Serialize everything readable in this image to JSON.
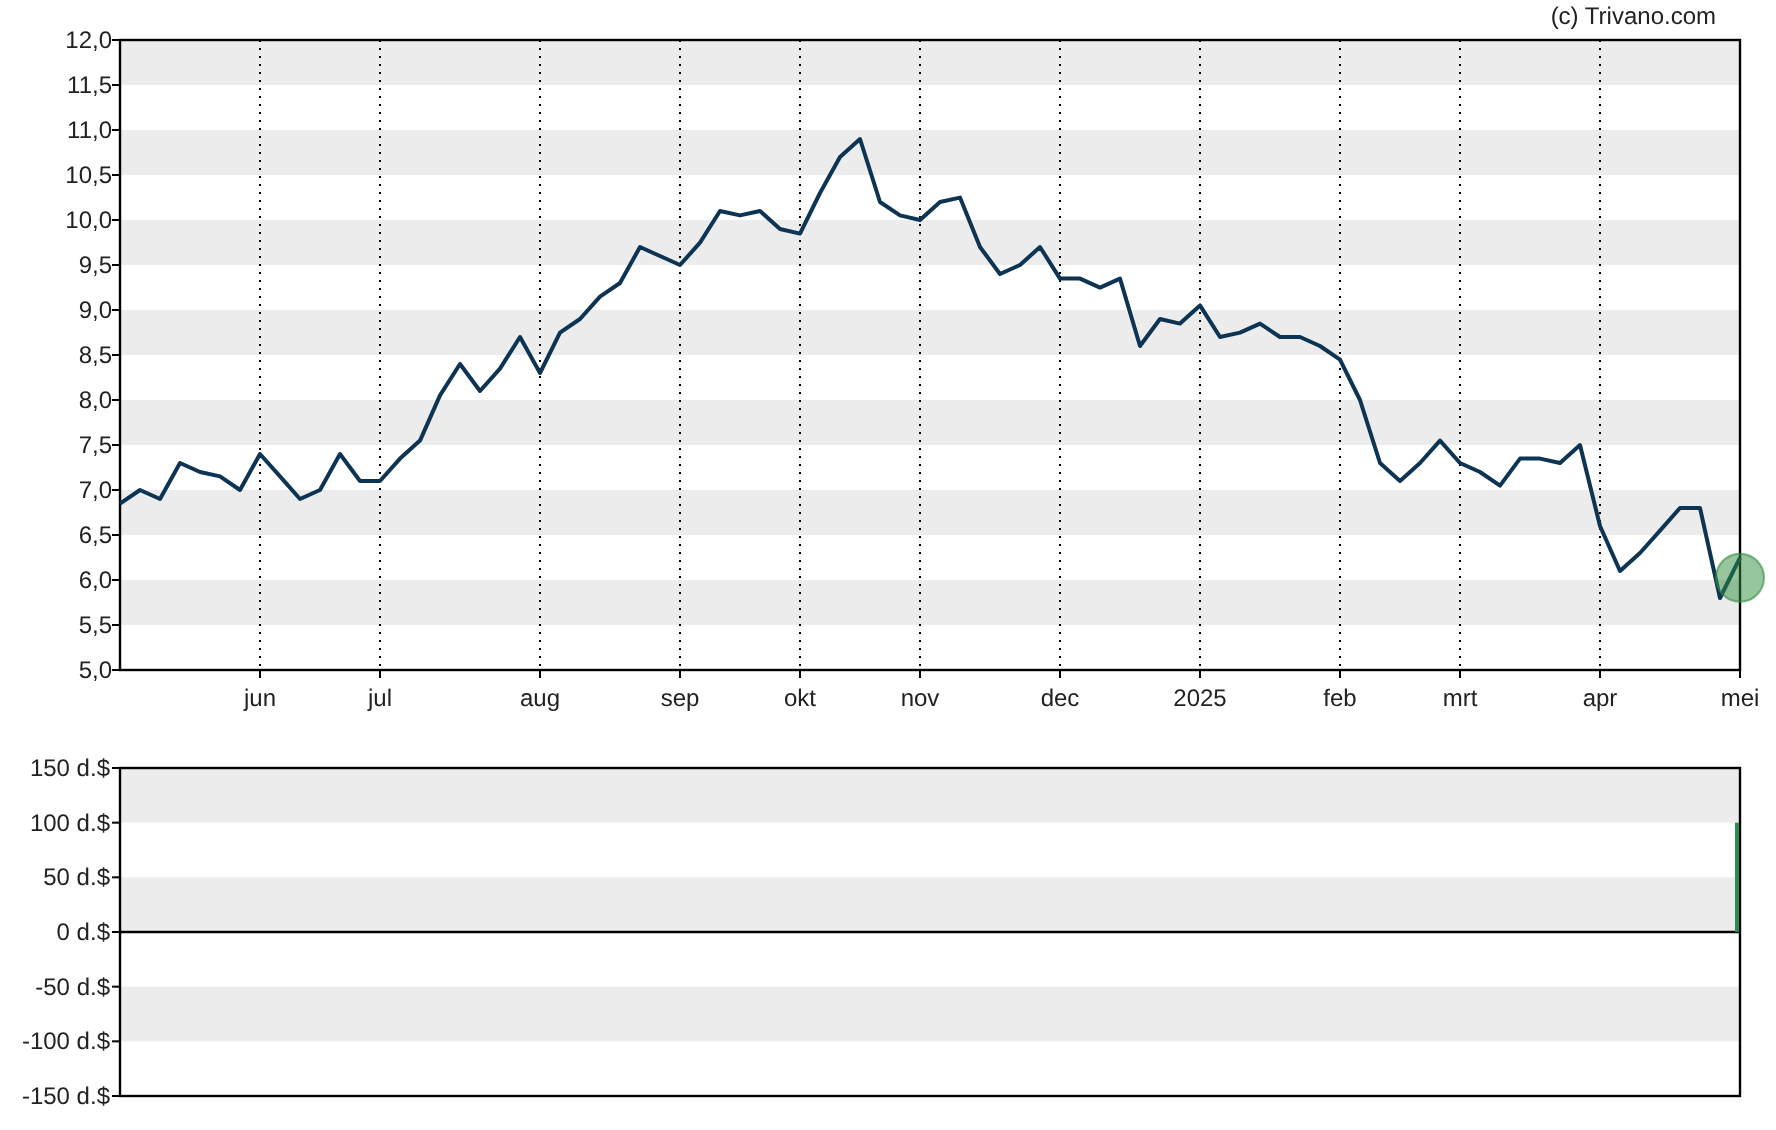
{
  "credit": "(c) Trivano.com",
  "price_chart": {
    "chart_data": {
      "type": "line",
      "grid": true,
      "ylim": [
        5,
        12
      ],
      "yticks": [
        {
          "value": 5,
          "label": "5,0"
        },
        {
          "value": 5.5,
          "label": "5,5"
        },
        {
          "value": 6,
          "label": "6,0"
        },
        {
          "value": 6.5,
          "label": "6,5"
        },
        {
          "value": 7,
          "label": "7,0"
        },
        {
          "value": 7.5,
          "label": "7,5"
        },
        {
          "value": 8,
          "label": "8,0"
        },
        {
          "value": 8.5,
          "label": "8,5"
        },
        {
          "value": 9,
          "label": "9,0"
        },
        {
          "value": 9.5,
          "label": "9,5"
        },
        {
          "value": 10,
          "label": "10,0"
        },
        {
          "value": 10.5,
          "label": "10,5"
        },
        {
          "value": 11,
          "label": "11,0"
        },
        {
          "value": 11.5,
          "label": "11,5"
        },
        {
          "value": 12,
          "label": "12,0"
        }
      ],
      "categories": [
        null,
        null,
        null,
        null,
        null,
        null,
        null,
        "jun",
        null,
        null,
        null,
        null,
        null,
        "jul",
        null,
        null,
        null,
        null,
        null,
        null,
        null,
        "aug",
        null,
        null,
        null,
        null,
        null,
        null,
        "sep",
        null,
        null,
        null,
        null,
        null,
        "okt",
        null,
        null,
        null,
        null,
        null,
        "nov",
        null,
        null,
        null,
        null,
        null,
        null,
        "dec",
        null,
        null,
        null,
        null,
        null,
        null,
        "2025",
        null,
        null,
        null,
        null,
        null,
        null,
        "feb",
        null,
        null,
        null,
        null,
        null,
        "mrt",
        null,
        null,
        null,
        null,
        null,
        null,
        "apr",
        null,
        null,
        null,
        null,
        null,
        null,
        "mei"
      ],
      "series": [
        {
          "color": "#0d3553",
          "values": [
            6.85,
            7.0,
            6.9,
            7.3,
            7.2,
            7.15,
            7.0,
            7.4,
            7.15,
            6.9,
            7.0,
            7.4,
            7.1,
            7.1,
            7.35,
            7.55,
            8.05,
            8.4,
            8.1,
            8.35,
            8.7,
            8.3,
            8.75,
            8.9,
            9.15,
            9.3,
            9.7,
            9.6,
            9.5,
            9.75,
            10.1,
            10.05,
            10.1,
            9.9,
            9.85,
            10.3,
            10.7,
            10.9,
            10.2,
            10.05,
            10.0,
            10.2,
            10.25,
            9.7,
            9.4,
            9.5,
            9.7,
            9.35,
            9.35,
            9.25,
            9.35,
            8.6,
            8.9,
            8.85,
            9.05,
            8.7,
            8.75,
            8.85,
            8.7,
            8.7,
            8.6,
            8.45,
            8.0,
            7.3,
            7.1,
            7.3,
            7.55,
            7.3,
            7.2,
            7.05,
            7.35,
            7.35,
            7.3,
            7.5,
            6.6,
            6.1,
            6.3,
            6.55,
            6.8,
            6.8,
            5.8,
            6.25
          ]
        }
      ]
    }
  },
  "volume_chart": {
    "chart_data": {
      "type": "bar",
      "ylim": [
        -150,
        150
      ],
      "yticks": [
        {
          "value": 150,
          "label": "150 d.$"
        },
        {
          "value": 100,
          "label": "100 d.$"
        },
        {
          "value": 50,
          "label": "50 d.$"
        },
        {
          "value": 0,
          "label": "0 d.$"
        },
        {
          "value": -50,
          "label": "-50 d.$"
        },
        {
          "value": -100,
          "label": "-100 d.$"
        },
        {
          "value": -150,
          "label": "-150 d.$"
        }
      ],
      "categories": [
        null,
        null,
        null,
        null,
        null,
        null,
        null,
        null,
        null,
        null,
        null,
        null,
        null,
        null,
        null,
        null,
        null,
        null,
        null,
        null,
        null,
        null,
        null,
        null,
        null,
        null,
        null,
        null,
        null,
        null,
        null,
        null,
        null,
        null,
        null,
        null,
        null,
        null,
        null,
        null,
        null,
        null,
        null,
        null,
        null,
        null,
        null,
        null,
        null,
        null,
        null,
        null,
        null,
        null,
        null,
        null,
        null,
        null,
        null,
        null,
        null,
        null,
        null,
        null,
        null,
        null,
        null,
        null,
        null,
        null,
        null,
        null,
        null,
        null,
        null,
        null,
        null,
        null,
        null,
        null,
        null,
        null
      ],
      "series": [
        {
          "color": "#2e8b4e",
          "values": [
            null,
            null,
            null,
            null,
            null,
            null,
            null,
            null,
            null,
            null,
            null,
            null,
            null,
            null,
            null,
            null,
            null,
            null,
            null,
            null,
            null,
            null,
            null,
            null,
            null,
            null,
            null,
            null,
            null,
            null,
            null,
            null,
            null,
            null,
            null,
            null,
            null,
            null,
            null,
            null,
            null,
            null,
            null,
            null,
            null,
            null,
            null,
            null,
            null,
            null,
            null,
            null,
            null,
            null,
            null,
            null,
            null,
            null,
            null,
            null,
            null,
            null,
            null,
            null,
            null,
            null,
            null,
            null,
            null,
            null,
            null,
            null,
            null,
            null,
            null,
            null,
            null,
            null,
            null,
            null,
            null,
            100
          ]
        }
      ]
    }
  }
}
